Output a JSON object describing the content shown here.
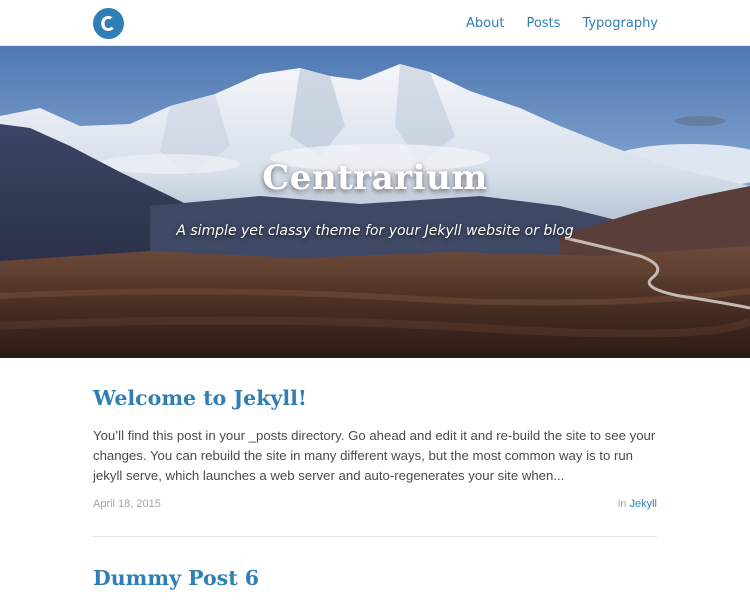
{
  "header": {
    "logo_letter": "c",
    "nav": [
      {
        "label": "About"
      },
      {
        "label": "Posts"
      },
      {
        "label": "Typography"
      }
    ],
    "accent_color": "#2f7fb6"
  },
  "hero": {
    "title": "Centrarium",
    "subtitle": "A simple yet classy theme for your Jekyll website or blog"
  },
  "posts": [
    {
      "title": "Welcome to Jekyll!",
      "excerpt": "You’ll find this post in your _posts directory. Go ahead and edit it and re-build the site to see your changes. You can rebuild the site in many different ways, but the most common way is to run jekyll serve, which launches a web server and auto-regenerates your site when...",
      "date": "April 18, 2015",
      "category_prefix": "in",
      "category": "Jekyll"
    },
    {
      "title": "Dummy Post 6"
    }
  ]
}
